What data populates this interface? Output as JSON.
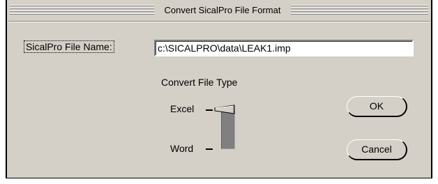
{
  "window": {
    "title": "Convert SicalPro File Format"
  },
  "form": {
    "file_name_label": "SicalPro File Name:",
    "file_name_value": "c:\\SICALPRO\\data\\LEAK1.imp"
  },
  "convert": {
    "section_label": "Convert File Type",
    "options": [
      {
        "label": "Excel"
      },
      {
        "label": "Word"
      }
    ],
    "selected": "Excel"
  },
  "buttons": {
    "ok_label": "OK",
    "cancel_label": "Cancel"
  },
  "colors": {
    "dialog_face": "#d4d0c8",
    "slider_bar": "#808080"
  }
}
